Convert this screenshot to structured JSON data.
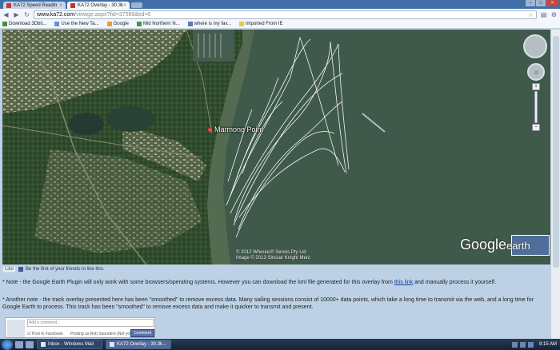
{
  "browser": {
    "tabs": [
      {
        "label": "KA72 Speed Readin"
      },
      {
        "label": "KA72 Overlay - 30.3k"
      }
    ],
    "url_domain": "www.ka72.com",
    "url_path": "/viewge.aspx?fid=37569&tid=0"
  },
  "bookmarks": [
    {
      "label": "Download 3Dbit...",
      "color": "#4a8f3a"
    },
    {
      "label": "Use the New Ta...",
      "color": "#6a8fd0"
    },
    {
      "label": "Google",
      "color": "#e8a23a"
    },
    {
      "label": "Mid Northern N...",
      "color": "#3a9a4a"
    },
    {
      "label": "where is my fav...",
      "color": "#5a7ab0"
    },
    {
      "label": "Imported From IE",
      "color": "#e8c84a"
    }
  ],
  "map": {
    "place_label": "Marmong Point",
    "copyright_1": "© 2012 Whereis® Sensis Pty Ltd",
    "copyright_2": "Image © 2013 Sinclair Knight Merz",
    "logo_google": "Google",
    "logo_earth": "earth"
  },
  "facebook": {
    "like_label": "Like",
    "prompt": "Be the first of your friends to like this."
  },
  "notes": {
    "note1_pre": "* Note - the Google Earth Plugin will only work with some browsers/operating systems. However you can download the kml file generated for this overlay from ",
    "note1_link": "this link",
    "note1_post": " and manually process it yourself.",
    "note2": "* Another note - the track overlay presented here has been \"smoothed\" to remove excess data. Many sailing sessions consist of 10000+ data points, which take a long time to transmit via the web, and a long time for Google Earth to process. This track has been \"smoothed\" to remove excess data and make it quicker to transmit and present."
  },
  "comment": {
    "placeholder": "Add a comment...",
    "post_to_facebook": "Post to Facebook",
    "posting_as": "Posting as Rob Saunders (Not you?)",
    "button": "Comment"
  },
  "taskbar": {
    "tasks": [
      {
        "label": "Inbox - Windows Mail"
      },
      {
        "label": "KA72 Overlay - 30.3k..."
      }
    ],
    "clock": "8:15 AM"
  }
}
